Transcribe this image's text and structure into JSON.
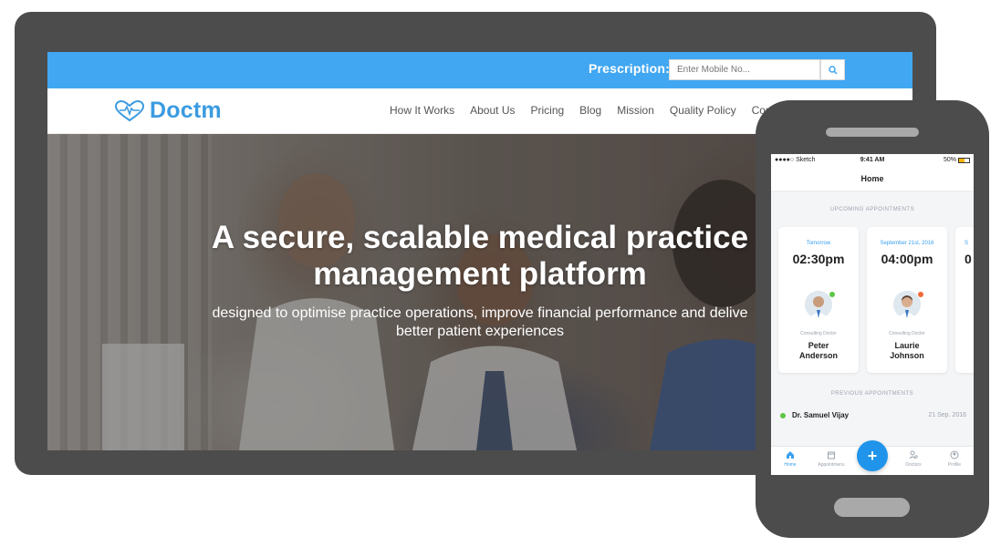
{
  "website": {
    "prescription": {
      "label": "Prescription:",
      "input_placeholder": "Enter Mobile No..."
    },
    "logo": {
      "text": "Doctm",
      "icon": "heartbeat-heart-icon"
    },
    "nav": [
      "How It Works",
      "About Us",
      "Pricing",
      "Blog",
      "Mission",
      "Quality Policy",
      "Cont"
    ],
    "hero": {
      "title_line1": "A secure, scalable medical practice",
      "title_line2": "management platform",
      "subtitle_line1": "designed to optimise practice operations, improve financial performance and delive",
      "subtitle_line2": "better patient experiences"
    }
  },
  "app": {
    "status_bar": {
      "carrier": "●●●●○ Sketch",
      "time": "9:41 AM",
      "battery": "50%"
    },
    "header_title": "Home",
    "upcoming_title": "UPCOMING APPOINTMENTS",
    "upcoming": [
      {
        "date": "Tomorrow",
        "time": "02:30pm",
        "role": "Consulting Doctor",
        "name_first": "Peter",
        "name_last": "Anderson",
        "status_color": "#5cc545"
      },
      {
        "date": "September 21st, 2016",
        "time": "04:00pm",
        "role": "Consulting Doctor",
        "name_first": "Laurie",
        "name_last": "Johnson",
        "status_color": "#f26b3a"
      }
    ],
    "third_card_partial": {
      "date": "S",
      "time": "0"
    },
    "previous_title": "PREVIOUS APPOINTMENTS",
    "previous": [
      {
        "name": "Dr. Samuel Vijay",
        "date": "21 Sep. 2016"
      }
    ],
    "tabs": [
      {
        "label": "Home",
        "icon": "home-icon",
        "active": true
      },
      {
        "label": "Appointmens",
        "icon": "calendar-icon",
        "active": false
      },
      {
        "label": "Doctors",
        "icon": "doctor-icon",
        "active": false
      },
      {
        "label": "Profile",
        "icon": "profile-icon",
        "active": false
      }
    ],
    "fab_label": "+"
  },
  "colors": {
    "brand_blue": "#41a7f2",
    "device_frame": "#4c4c4c",
    "online_green": "#5cc545",
    "busy_orange": "#f26b3a"
  }
}
